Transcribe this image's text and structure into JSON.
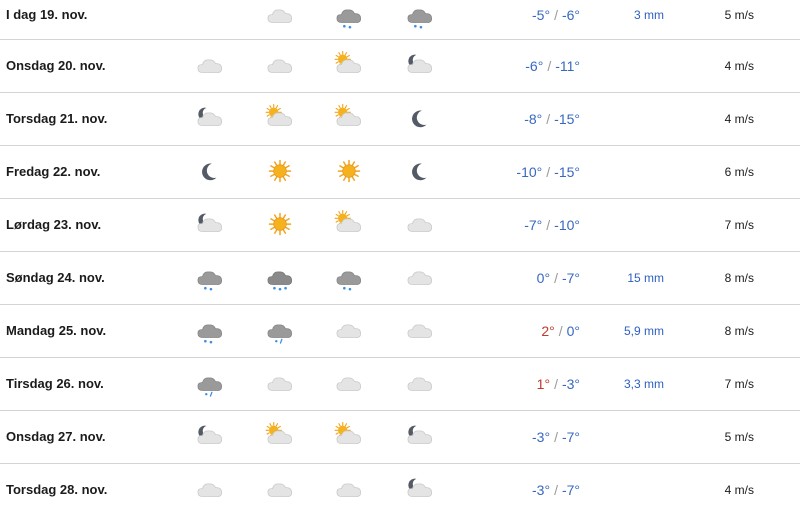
{
  "forecast": {
    "rows": [
      {
        "day": "I dag 19. nov.",
        "icons": [
          "",
          "cloud",
          "snow-cloud",
          "snow-cloud"
        ],
        "max": "-5°",
        "min": "-6°",
        "precip": "3 mm",
        "wind": "5 m/s"
      },
      {
        "day": "Onsdag 20. nov.",
        "icons": [
          "cloud",
          "cloud",
          "sun-cloud",
          "moon-cloud"
        ],
        "max": "-6°",
        "min": "-11°",
        "precip": "",
        "wind": "4 m/s"
      },
      {
        "day": "Torsdag 21. nov.",
        "icons": [
          "moon-cloud",
          "sun-cloud",
          "sun-cloud",
          "moon"
        ],
        "max": "-8°",
        "min": "-15°",
        "precip": "",
        "wind": "4 m/s"
      },
      {
        "day": "Fredag 22. nov.",
        "icons": [
          "moon",
          "sun",
          "sun",
          "moon"
        ],
        "max": "-10°",
        "min": "-15°",
        "precip": "",
        "wind": "6 m/s"
      },
      {
        "day": "Lørdag 23. nov.",
        "icons": [
          "moon-cloud",
          "sun",
          "sun-cloud",
          "cloud"
        ],
        "max": "-7°",
        "min": "-10°",
        "precip": "",
        "wind": "7 m/s"
      },
      {
        "day": "Søndag 24. nov.",
        "icons": [
          "snow-cloud",
          "heavy-snow-cloud",
          "snow-cloud",
          "cloud"
        ],
        "max": "0°",
        "min": "-7°",
        "precip": "15 mm",
        "wind": "8 m/s"
      },
      {
        "day": "Mandag 25. nov.",
        "icons": [
          "snow-cloud",
          "sleet-cloud",
          "cloud",
          "cloud"
        ],
        "max": "2°",
        "min": "0°",
        "precip": "5,9 mm",
        "wind": "8 m/s"
      },
      {
        "day": "Tirsdag 26. nov.",
        "icons": [
          "sleet-cloud",
          "cloud",
          "cloud",
          "cloud"
        ],
        "max": "1°",
        "min": "-3°",
        "precip": "3,3 mm",
        "wind": "7 m/s"
      },
      {
        "day": "Onsdag 27. nov.",
        "icons": [
          "moon-cloud",
          "sun-cloud",
          "sun-cloud",
          "moon-cloud"
        ],
        "max": "-3°",
        "min": "-7°",
        "precip": "",
        "wind": "5 m/s"
      },
      {
        "day": "Torsdag 28. nov.",
        "icons": [
          "cloud",
          "cloud",
          "cloud",
          "moon-cloud"
        ],
        "max": "-3°",
        "min": "-7°",
        "precip": "",
        "wind": "4 m/s"
      }
    ]
  },
  "colors": {
    "cold": "#3868c0",
    "warm": "#c0392b",
    "precip": "#2e5fc0"
  }
}
